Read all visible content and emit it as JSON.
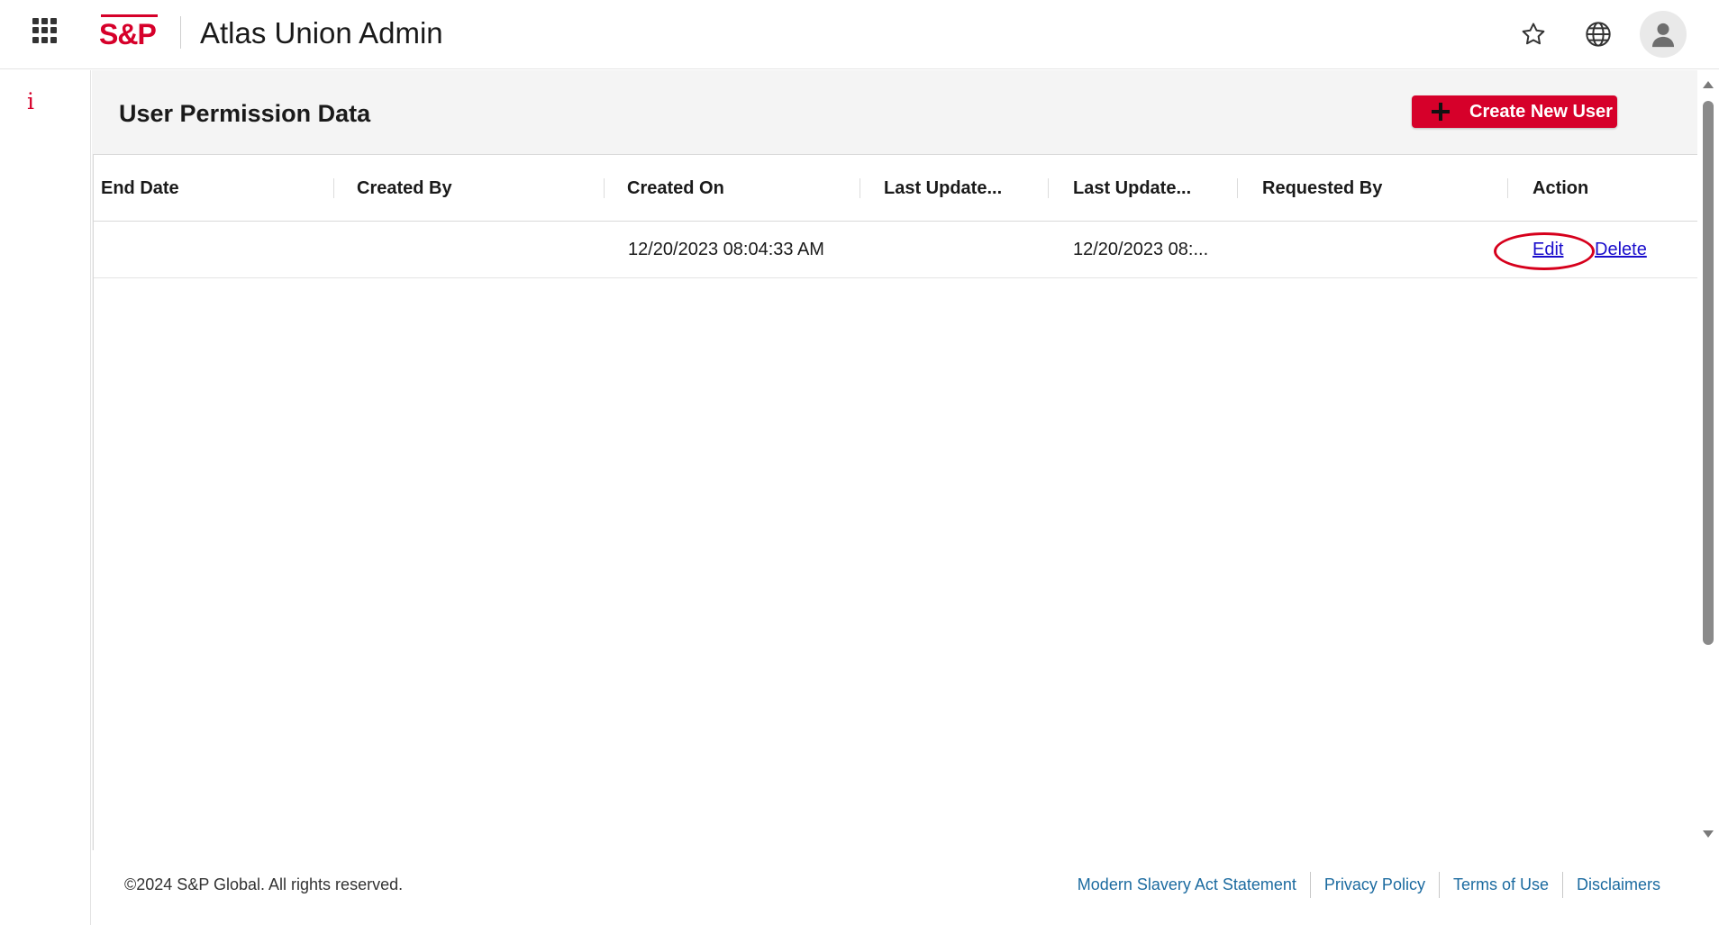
{
  "header": {
    "logo_text": "S&P",
    "app_title": "Atlas Union Admin",
    "icons": [
      "apps-grid-icon",
      "star-icon",
      "globe-icon",
      "user-avatar-icon"
    ]
  },
  "left_rail": {
    "info_glyph": "i"
  },
  "panel": {
    "title": "User Permission Data",
    "create_button_label": "Create New User"
  },
  "table": {
    "columns": [
      "End Date",
      "Created By",
      "Created On",
      "Last Update...",
      "Last Update...",
      "Requested By",
      "Action"
    ],
    "rows": [
      {
        "end_date": "",
        "created_by": "",
        "created_on": "12/20/2023 08:04:33 AM",
        "last_updated_by": "",
        "last_updated_on": "12/20/2023 08:...",
        "requested_by": "",
        "actions": {
          "edit": "Edit",
          "delete": "Delete"
        }
      }
    ]
  },
  "footer": {
    "copyright": "©2024 S&P Global. All rights reserved.",
    "links": [
      "Modern Slavery Act Statement",
      "Privacy Policy",
      "Terms of Use",
      "Disclaimers"
    ]
  },
  "colors": {
    "brand_red": "#d6002a",
    "highlight_red": "#d6001c",
    "link_blue": "#1a0dcc",
    "footer_link_blue": "#1c6ba0",
    "panel_bg": "#f4f4f4"
  }
}
